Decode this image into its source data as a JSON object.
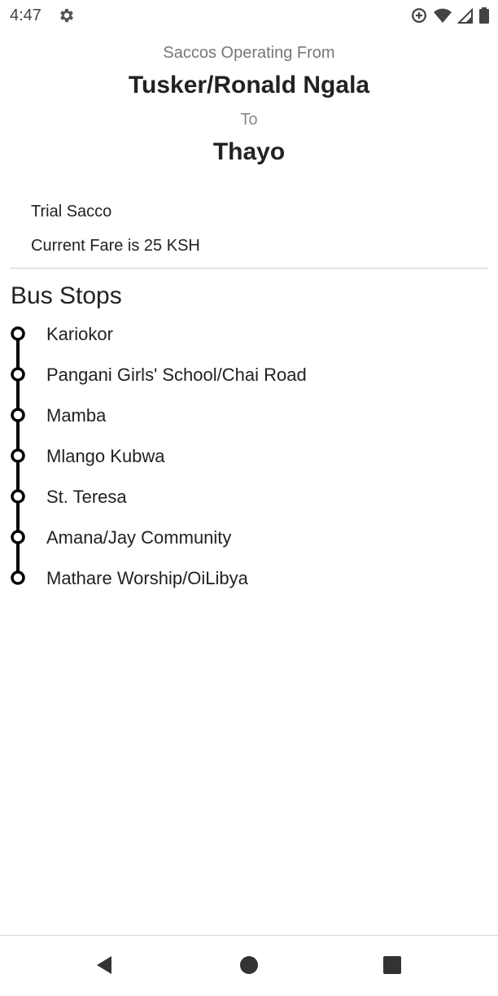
{
  "status_bar": {
    "time": "4:47",
    "icons": [
      "settings-icon",
      "data-saver-icon",
      "wifi-icon",
      "cell-signal-icon",
      "battery-icon"
    ]
  },
  "header": {
    "subtitle": "Saccos Operating From",
    "origin": "Tusker/Ronald Ngala",
    "to_label": "To",
    "destination": "Thayo"
  },
  "sacco": {
    "name": "Trial Sacco",
    "fare": "Current Fare is 25 KSH"
  },
  "stops_section": {
    "title": "Bus Stops",
    "stops": [
      "Kariokor",
      "Pangani Girls' School/Chai Road",
      "Mamba",
      "Mlango Kubwa",
      "St. Teresa",
      "Amana/Jay Community",
      "Mathare Worship/OiLibya"
    ]
  },
  "nav": {
    "buttons": [
      "back-icon",
      "home-icon",
      "recents-icon"
    ]
  }
}
